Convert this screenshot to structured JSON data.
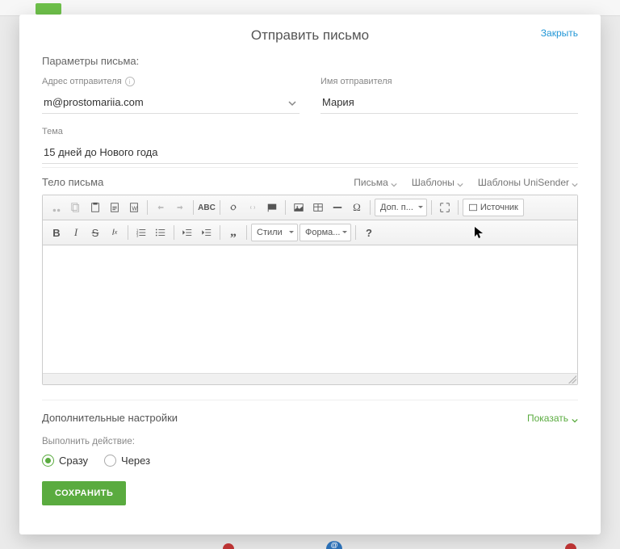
{
  "header": {
    "title": "Отправить письмо",
    "close": "Закрыть"
  },
  "params": {
    "section_title": "Параметры письма:",
    "sender_addr_label": "Адрес отправителя",
    "sender_addr_value": "m@prostomariia.com",
    "sender_name_label": "Имя отправителя",
    "sender_name_value": "Мария",
    "subject_label": "Тема",
    "subject_value": "15 дней до Нового года"
  },
  "body": {
    "title": "Тело письма",
    "tab_letters": "Письма",
    "tab_templates": "Шаблоны",
    "tab_unisender": "Шаблоны UniSender"
  },
  "toolbar": {
    "extras": "Доп. п...",
    "source": "Источник",
    "styles": "Стили",
    "format": "Форма..."
  },
  "additional": {
    "title": "Дополнительные настройки",
    "show": "Показать"
  },
  "action": {
    "label": "Выполнить действие:",
    "now": "Сразу",
    "after": "Через"
  },
  "save": "СОХРАНИТЬ"
}
